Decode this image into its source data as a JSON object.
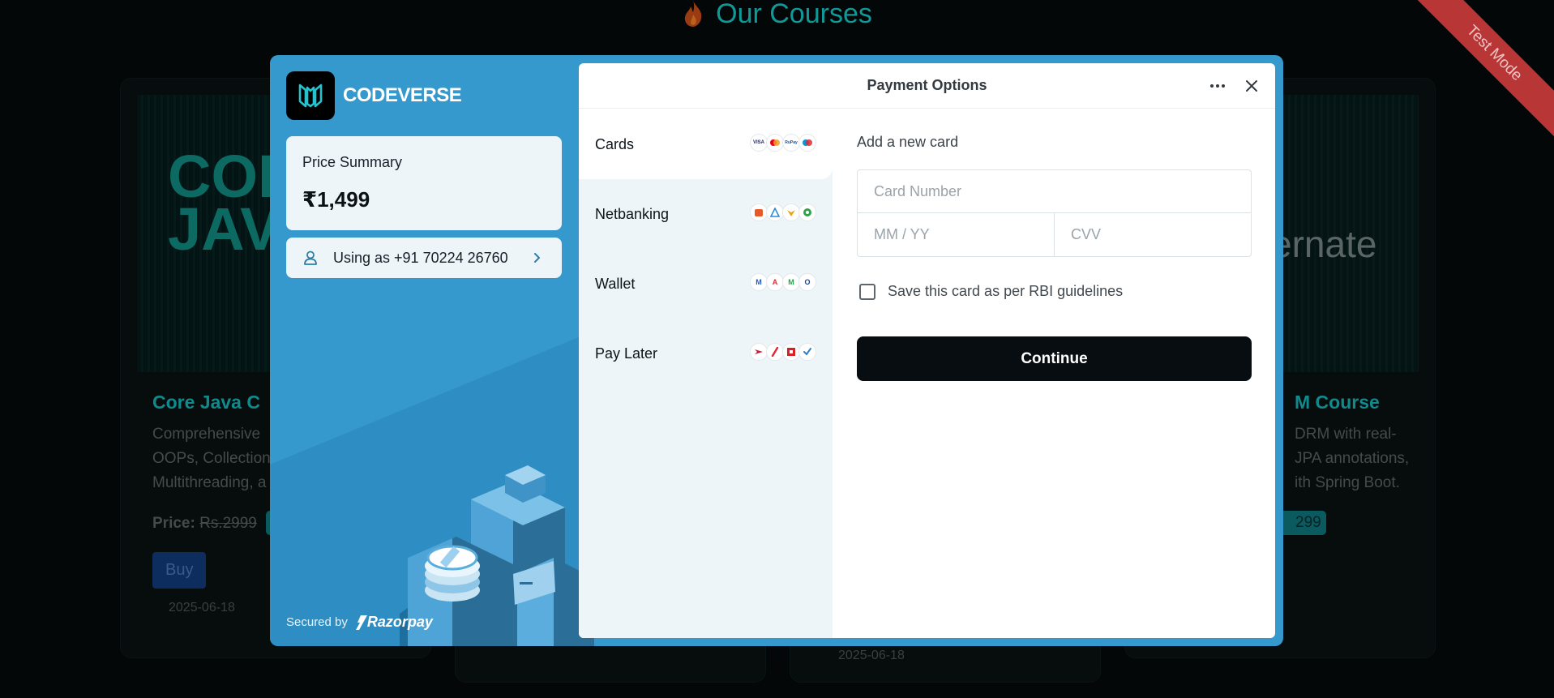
{
  "page": {
    "title": "Our Courses",
    "test_mode_ribbon": "Test Mode",
    "courses": [
      {
        "thumb_text": [
          "COR",
          "JAV"
        ],
        "title": "Core Java C",
        "desc": [
          "Comprehensive",
          "OOPs, Collection",
          "Multithreading, a"
        ],
        "price_label": "Price:",
        "old_price": "Rs.2999",
        "buy_label": "Buy",
        "date": "2025-06-18"
      },
      {
        "date": "2025-06-18"
      },
      {
        "thumb_text": [
          "ernate"
        ],
        "title": "M Course",
        "desc": [
          "DRM with real-",
          "JPA annotations,",
          "ith Spring Boot."
        ],
        "price_chip": "299"
      }
    ]
  },
  "modal": {
    "brand_name": "CODEVERSE",
    "price_summary_label": "Price Summary",
    "price_amount": "₹1,499",
    "contact_text": "Using as +91 70224 26760",
    "secured_by": "Secured by",
    "razorpay_label": "Razorpay",
    "panel_title": "Payment Options",
    "methods": [
      {
        "label": "Cards",
        "logos": [
          {
            "t": "VISA",
            "c": "#1a1f71"
          },
          {
            "t": "●●",
            "c": "#eb001b"
          },
          {
            "t": "RuPay",
            "c": "#1f4b99"
          },
          {
            "t": "●●",
            "c": "#0099df"
          }
        ]
      },
      {
        "label": "Netbanking",
        "logos": [
          {
            "t": "■",
            "c": "#e75a28"
          },
          {
            "t": "▲",
            "c": "#2d8bd7"
          },
          {
            "t": "◆",
            "c": "#e8a317"
          },
          {
            "t": "●",
            "c": "#2fa34b"
          }
        ]
      },
      {
        "label": "Wallet",
        "logos": [
          {
            "t": "M",
            "c": "#1e5bc6"
          },
          {
            "t": "A",
            "c": "#e0282e"
          },
          {
            "t": "M",
            "c": "#22a34a"
          },
          {
            "t": "O",
            "c": "#1d3d8f"
          }
        ]
      },
      {
        "label": "Pay Later",
        "logos": [
          {
            "t": "▶",
            "c": "#c71a3f"
          },
          {
            "t": "/",
            "c": "#e0282e"
          },
          {
            "t": "◘",
            "c": "#d71f26"
          },
          {
            "t": "✓",
            "c": "#2a7fd4"
          }
        ]
      }
    ],
    "form": {
      "heading": "Add a new card",
      "card_number_placeholder": "Card Number",
      "expiry_placeholder": "MM / YY",
      "cvv_placeholder": "CVV",
      "save_label": "Save this card as per RBI guidelines",
      "continue_label": "Continue"
    }
  },
  "colors": {
    "modal_bg": "#3699cd",
    "continue_bg": "#070d11",
    "ribbon": "#d84444",
    "accent_teal": "#16b6b2"
  },
  "icons": [
    "flame-icon",
    "codeverse-logo-icon",
    "user-icon",
    "chevron-right-icon",
    "more-icon",
    "close-icon",
    "razorpay-icon"
  ]
}
